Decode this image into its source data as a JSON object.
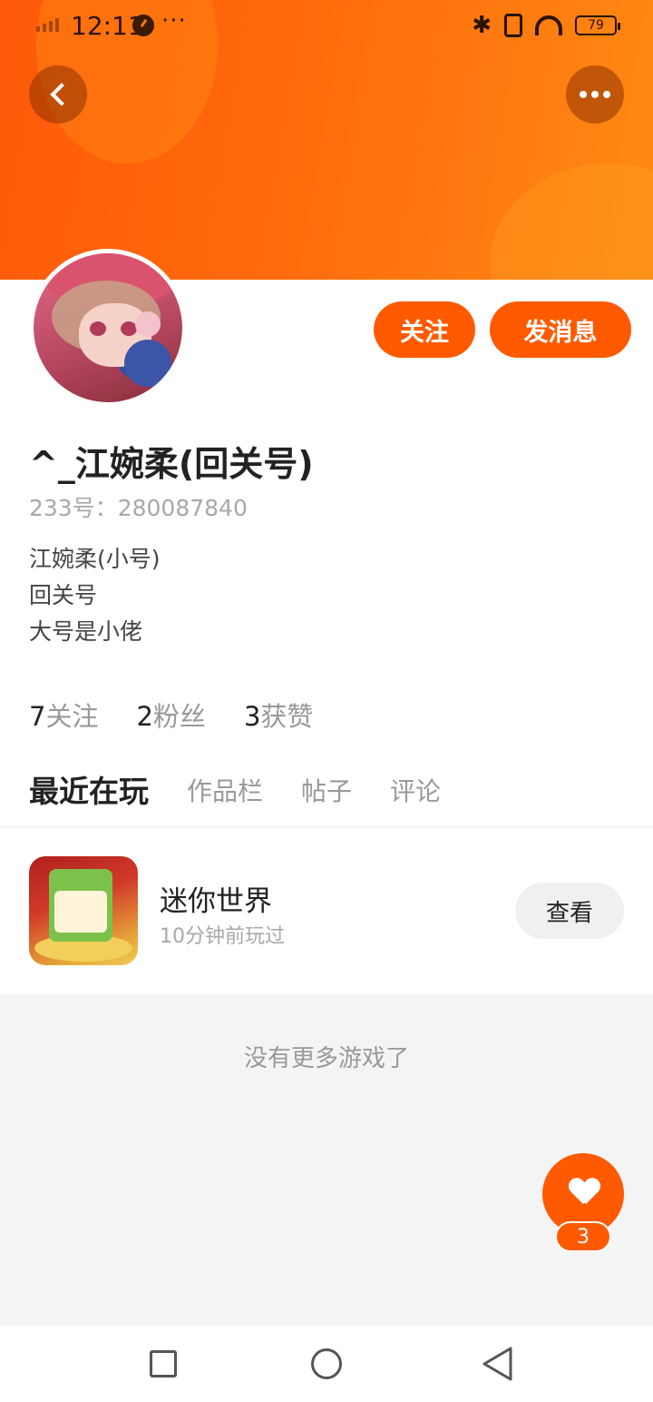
{
  "status_bar": {
    "time": "12:11",
    "extra": "···",
    "battery": "79"
  },
  "header": {
    "back_icon": "chevron-left-icon",
    "more_icon": "more-dots-icon"
  },
  "profile": {
    "nickname": "^_江婉柔(回关号)",
    "uid_line": "233号：280087840",
    "bio": [
      "江婉柔(小号)",
      "回关号",
      "大号是小佬"
    ],
    "follow_label": "关注",
    "message_label": "发消息"
  },
  "stats": [
    {
      "num": "7",
      "label": "关注"
    },
    {
      "num": "2",
      "label": "粉丝"
    },
    {
      "num": "3",
      "label": "获赞"
    }
  ],
  "tabs": [
    {
      "label": "最近在玩",
      "active": true
    },
    {
      "label": "作品栏",
      "active": false
    },
    {
      "label": "帖子",
      "active": false
    },
    {
      "label": "评论",
      "active": false
    }
  ],
  "recent_game": {
    "title": "迷你世界",
    "subtitle": "10分钟前玩过",
    "view_label": "查看"
  },
  "list_footer": "没有更多游戏了",
  "like": {
    "count": "3"
  },
  "colors": {
    "accent": "#ff5a00",
    "banner_start": "#ff5a0a",
    "banner_end": "#ff8a14"
  }
}
